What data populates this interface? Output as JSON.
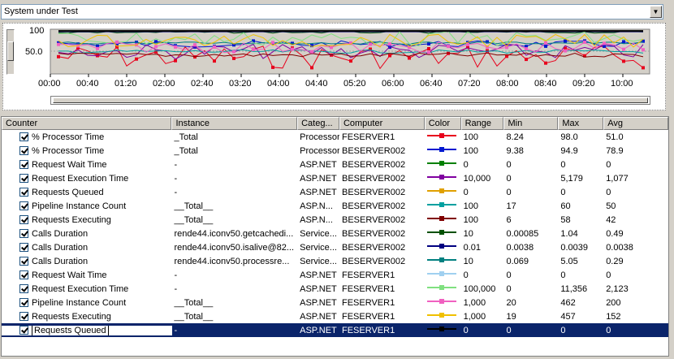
{
  "dropdown": {
    "selected": "System under Test"
  },
  "graph": {
    "y_labels": [
      "100",
      "50.0"
    ],
    "x_labels": [
      "00:00",
      "00:40",
      "01:20",
      "02:00",
      "02:40",
      "03:20",
      "04:00",
      "04:40",
      "05:20",
      "06:00",
      "06:40",
      "07:20",
      "08:00",
      "08:40",
      "09:20",
      "10:00"
    ]
  },
  "columns": [
    "Counter",
    "Instance",
    "Categ...",
    "Computer",
    "Color",
    "Range",
    "Min",
    "Max",
    "Avg"
  ],
  "rows": [
    {
      "counter": "% Processor Time",
      "instance": "_Total",
      "category": "Processor",
      "computer": "FESERVER1",
      "color": "#e8001c",
      "range": "100",
      "min": "8.24",
      "max": "98.0",
      "avg": "51.0"
    },
    {
      "counter": "% Processor Time",
      "instance": "_Total",
      "category": "Processor",
      "computer": "BESERVER002",
      "color": "#0018d0",
      "range": "100",
      "min": "9.38",
      "max": "94.9",
      "avg": "78.9"
    },
    {
      "counter": "Request Wait Time",
      "instance": "-",
      "category": "ASP.NET",
      "computer": "BESERVER002",
      "color": "#008000",
      "range": "0",
      "min": "0",
      "max": "0",
      "avg": "0"
    },
    {
      "counter": "Request Execution Time",
      "instance": "-",
      "category": "ASP.NET",
      "computer": "BESERVER002",
      "color": "#8000a0",
      "range": "10,000",
      "min": "0",
      "max": "5,179",
      "avg": "1,077"
    },
    {
      "counter": "Requests Queued",
      "instance": "-",
      "category": "ASP.NET",
      "computer": "BESERVER002",
      "color": "#e0a000",
      "range": "0",
      "min": "0",
      "max": "0",
      "avg": "0"
    },
    {
      "counter": "Pipeline Instance Count",
      "instance": "__Total__",
      "category": "ASP.N...",
      "computer": "BESERVER002",
      "color": "#00a0a0",
      "range": "100",
      "min": "17",
      "max": "60",
      "avg": "50"
    },
    {
      "counter": "Requests Executing",
      "instance": "__Total__",
      "category": "ASP.N...",
      "computer": "BESERVER002",
      "color": "#800000",
      "range": "100",
      "min": "6",
      "max": "58",
      "avg": "42"
    },
    {
      "counter": "Calls Duration",
      "instance": "rende44.iconv50.getcachedi...",
      "category": "Service...",
      "computer": "BESERVER002",
      "color": "#005000",
      "range": "10",
      "min": "0.00085",
      "max": "1.04",
      "avg": "0.49"
    },
    {
      "counter": "Calls Duration",
      "instance": "rende44.iconv50.isalive@82...",
      "category": "Service...",
      "computer": "BESERVER002",
      "color": "#000080",
      "range": "0.01",
      "min": "0.0038",
      "max": "0.0039",
      "avg": "0.0038"
    },
    {
      "counter": "Calls Duration",
      "instance": "rende44.iconv50.processre...",
      "category": "Service...",
      "computer": "BESERVER002",
      "color": "#008080",
      "range": "10",
      "min": "0.069",
      "max": "5.05",
      "avg": "0.29"
    },
    {
      "counter": "Request Wait Time",
      "instance": "-",
      "category": "ASP.NET",
      "computer": "FESERVER1",
      "color": "#a0d0f0",
      "range": "0",
      "min": "0",
      "max": "0",
      "avg": "0"
    },
    {
      "counter": "Request Execution Time",
      "instance": "-",
      "category": "ASP.NET",
      "computer": "FESERVER1",
      "color": "#80e080",
      "range": "100,000",
      "min": "0",
      "max": "11,356",
      "avg": "2,123"
    },
    {
      "counter": "Pipeline Instance Count",
      "instance": "__Total__",
      "category": "ASP.NET",
      "computer": "FESERVER1",
      "color": "#f060c0",
      "range": "1,000",
      "min": "20",
      "max": "462",
      "avg": "200"
    },
    {
      "counter": "Requests Executing",
      "instance": "__Total__",
      "category": "ASP.NET",
      "computer": "FESERVER1",
      "color": "#f0c000",
      "range": "1,000",
      "min": "19",
      "max": "457",
      "avg": "152"
    },
    {
      "counter": "Requests Queued",
      "instance": "-",
      "category": "ASP.NET",
      "computer": "FESERVER1",
      "color": "#000000",
      "range": "0",
      "min": "0",
      "max": "0",
      "avg": "0"
    }
  ],
  "selected_row": 14
}
